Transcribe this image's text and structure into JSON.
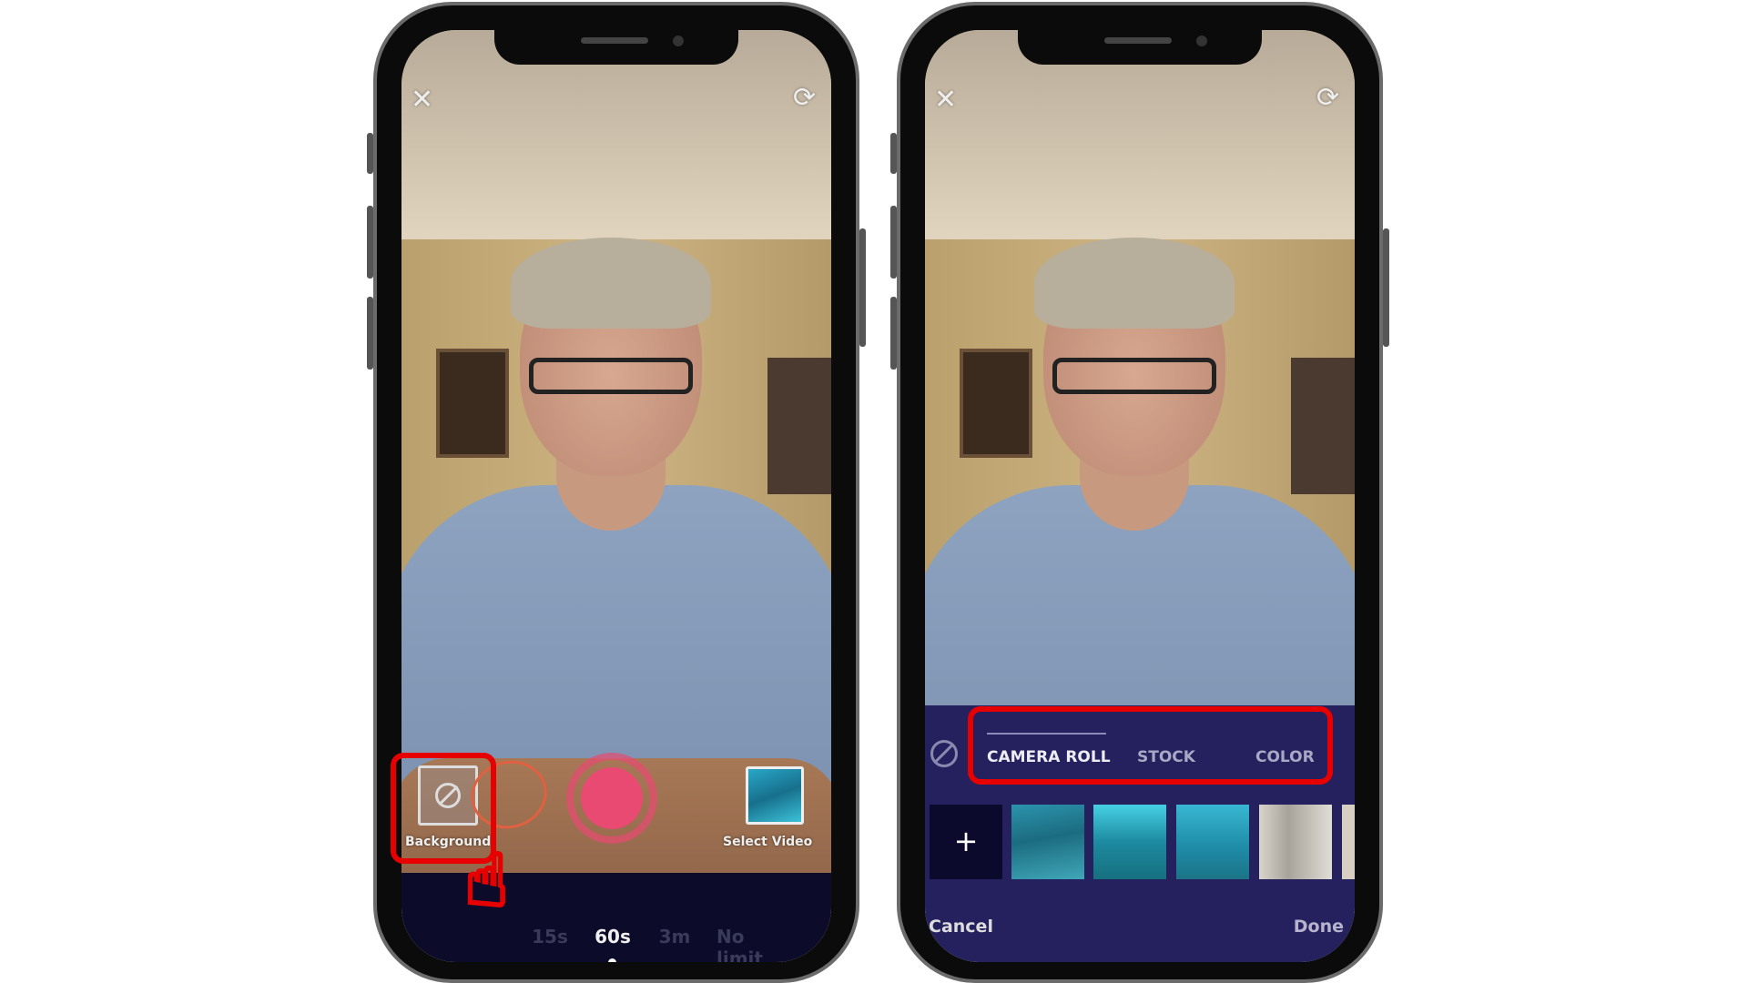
{
  "left_phone": {
    "close_icon": "close-icon",
    "flip_icon": "refresh-camera-icon",
    "background_button": {
      "label": "Background",
      "icon": "no-background-icon"
    },
    "record_button": {
      "color": "#e84a72"
    },
    "select_video": {
      "label": "Select Video"
    },
    "durations": [
      {
        "label": "15s",
        "active": false
      },
      {
        "label": "60s",
        "active": true
      },
      {
        "label": "3m",
        "active": false
      },
      {
        "label": "No limit",
        "active": false
      }
    ],
    "highlight_color": "#e60000",
    "cursor_icon": "hand-pointer-icon"
  },
  "right_phone": {
    "close_icon": "close-icon",
    "flip_icon": "refresh-camera-icon",
    "none_icon": "no-background-icon",
    "tabs": [
      {
        "label": "CAMERA ROLL",
        "active": true
      },
      {
        "label": "STOCK",
        "active": false
      },
      {
        "label": "COLOR",
        "active": false
      }
    ],
    "add_icon": "+",
    "cancel_label": "Cancel",
    "done_label": "Done",
    "panel_color": "#25215e",
    "highlight_color": "#e60000"
  }
}
